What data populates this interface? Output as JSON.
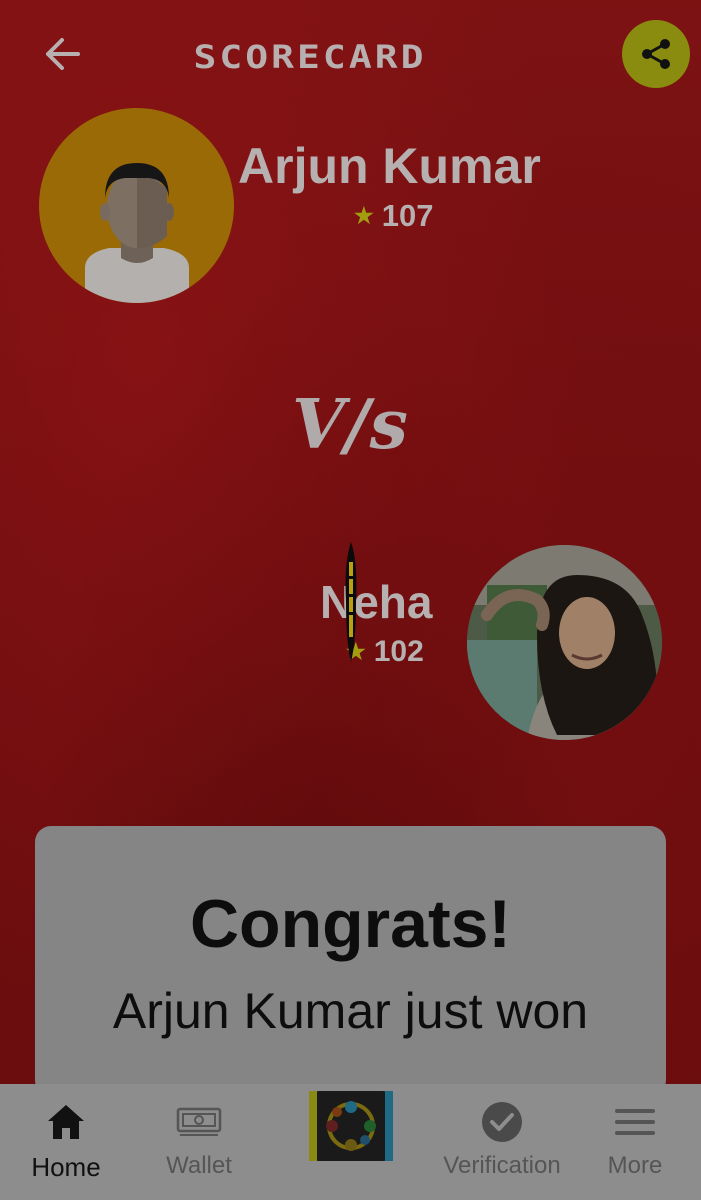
{
  "header": {
    "title": "SCORECARD",
    "back_icon": "arrow-left-icon",
    "share_icon": "share-icon",
    "share_color": "#8a8c0f"
  },
  "player1": {
    "name": "Arjun Kumar",
    "score": "107",
    "avatar_icon": "male-avatar-icon",
    "avatar_bg": "#9a6a06"
  },
  "versus": "V/s",
  "player2": {
    "name": "Neha",
    "score": "102",
    "avatar": "profile-photo"
  },
  "result": {
    "headline": "Congrats!",
    "message": "Arjun Kumar just won"
  },
  "nav": {
    "items": [
      {
        "label": "Home",
        "icon": "home-icon",
        "active": true
      },
      {
        "label": "Wallet",
        "icon": "wallet-icon",
        "active": false
      },
      {
        "label": "",
        "icon": "app-logo-icon",
        "active": false
      },
      {
        "label": "Verification",
        "icon": "check-circle-icon",
        "active": false
      },
      {
        "label": "More",
        "icon": "menu-icon",
        "active": false
      }
    ]
  },
  "colors": {
    "star": "#a39e10",
    "background": "#6e0e10"
  }
}
